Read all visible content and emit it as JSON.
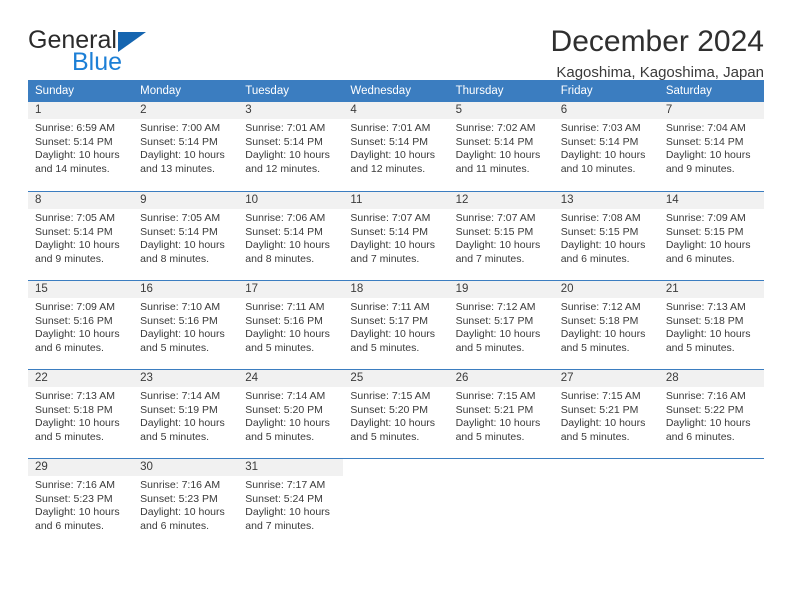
{
  "brand": {
    "word1": "General",
    "word2": "Blue",
    "triangle_color": "#1565b0",
    "blue_color": "#1c7fd6"
  },
  "header": {
    "title": "December 2024",
    "subtitle": "Kagoshima, Kagoshima, Japan"
  },
  "calendar": {
    "header_bg": "#3b7dc0",
    "daynum_bg": "#f1f1f1",
    "weekdays": [
      "Sunday",
      "Monday",
      "Tuesday",
      "Wednesday",
      "Thursday",
      "Friday",
      "Saturday"
    ],
    "weeks": [
      [
        {
          "day": "1",
          "sunrise": "Sunrise: 6:59 AM",
          "sunset": "Sunset: 5:14 PM",
          "daylight1": "Daylight: 10 hours",
          "daylight2": "and 14 minutes."
        },
        {
          "day": "2",
          "sunrise": "Sunrise: 7:00 AM",
          "sunset": "Sunset: 5:14 PM",
          "daylight1": "Daylight: 10 hours",
          "daylight2": "and 13 minutes."
        },
        {
          "day": "3",
          "sunrise": "Sunrise: 7:01 AM",
          "sunset": "Sunset: 5:14 PM",
          "daylight1": "Daylight: 10 hours",
          "daylight2": "and 12 minutes."
        },
        {
          "day": "4",
          "sunrise": "Sunrise: 7:01 AM",
          "sunset": "Sunset: 5:14 PM",
          "daylight1": "Daylight: 10 hours",
          "daylight2": "and 12 minutes."
        },
        {
          "day": "5",
          "sunrise": "Sunrise: 7:02 AM",
          "sunset": "Sunset: 5:14 PM",
          "daylight1": "Daylight: 10 hours",
          "daylight2": "and 11 minutes."
        },
        {
          "day": "6",
          "sunrise": "Sunrise: 7:03 AM",
          "sunset": "Sunset: 5:14 PM",
          "daylight1": "Daylight: 10 hours",
          "daylight2": "and 10 minutes."
        },
        {
          "day": "7",
          "sunrise": "Sunrise: 7:04 AM",
          "sunset": "Sunset: 5:14 PM",
          "daylight1": "Daylight: 10 hours",
          "daylight2": "and 9 minutes."
        }
      ],
      [
        {
          "day": "8",
          "sunrise": "Sunrise: 7:05 AM",
          "sunset": "Sunset: 5:14 PM",
          "daylight1": "Daylight: 10 hours",
          "daylight2": "and 9 minutes."
        },
        {
          "day": "9",
          "sunrise": "Sunrise: 7:05 AM",
          "sunset": "Sunset: 5:14 PM",
          "daylight1": "Daylight: 10 hours",
          "daylight2": "and 8 minutes."
        },
        {
          "day": "10",
          "sunrise": "Sunrise: 7:06 AM",
          "sunset": "Sunset: 5:14 PM",
          "daylight1": "Daylight: 10 hours",
          "daylight2": "and 8 minutes."
        },
        {
          "day": "11",
          "sunrise": "Sunrise: 7:07 AM",
          "sunset": "Sunset: 5:14 PM",
          "daylight1": "Daylight: 10 hours",
          "daylight2": "and 7 minutes."
        },
        {
          "day": "12",
          "sunrise": "Sunrise: 7:07 AM",
          "sunset": "Sunset: 5:15 PM",
          "daylight1": "Daylight: 10 hours",
          "daylight2": "and 7 minutes."
        },
        {
          "day": "13",
          "sunrise": "Sunrise: 7:08 AM",
          "sunset": "Sunset: 5:15 PM",
          "daylight1": "Daylight: 10 hours",
          "daylight2": "and 6 minutes."
        },
        {
          "day": "14",
          "sunrise": "Sunrise: 7:09 AM",
          "sunset": "Sunset: 5:15 PM",
          "daylight1": "Daylight: 10 hours",
          "daylight2": "and 6 minutes."
        }
      ],
      [
        {
          "day": "15",
          "sunrise": "Sunrise: 7:09 AM",
          "sunset": "Sunset: 5:16 PM",
          "daylight1": "Daylight: 10 hours",
          "daylight2": "and 6 minutes."
        },
        {
          "day": "16",
          "sunrise": "Sunrise: 7:10 AM",
          "sunset": "Sunset: 5:16 PM",
          "daylight1": "Daylight: 10 hours",
          "daylight2": "and 5 minutes."
        },
        {
          "day": "17",
          "sunrise": "Sunrise: 7:11 AM",
          "sunset": "Sunset: 5:16 PM",
          "daylight1": "Daylight: 10 hours",
          "daylight2": "and 5 minutes."
        },
        {
          "day": "18",
          "sunrise": "Sunrise: 7:11 AM",
          "sunset": "Sunset: 5:17 PM",
          "daylight1": "Daylight: 10 hours",
          "daylight2": "and 5 minutes."
        },
        {
          "day": "19",
          "sunrise": "Sunrise: 7:12 AM",
          "sunset": "Sunset: 5:17 PM",
          "daylight1": "Daylight: 10 hours",
          "daylight2": "and 5 minutes."
        },
        {
          "day": "20",
          "sunrise": "Sunrise: 7:12 AM",
          "sunset": "Sunset: 5:18 PM",
          "daylight1": "Daylight: 10 hours",
          "daylight2": "and 5 minutes."
        },
        {
          "day": "21",
          "sunrise": "Sunrise: 7:13 AM",
          "sunset": "Sunset: 5:18 PM",
          "daylight1": "Daylight: 10 hours",
          "daylight2": "and 5 minutes."
        }
      ],
      [
        {
          "day": "22",
          "sunrise": "Sunrise: 7:13 AM",
          "sunset": "Sunset: 5:18 PM",
          "daylight1": "Daylight: 10 hours",
          "daylight2": "and 5 minutes."
        },
        {
          "day": "23",
          "sunrise": "Sunrise: 7:14 AM",
          "sunset": "Sunset: 5:19 PM",
          "daylight1": "Daylight: 10 hours",
          "daylight2": "and 5 minutes."
        },
        {
          "day": "24",
          "sunrise": "Sunrise: 7:14 AM",
          "sunset": "Sunset: 5:20 PM",
          "daylight1": "Daylight: 10 hours",
          "daylight2": "and 5 minutes."
        },
        {
          "day": "25",
          "sunrise": "Sunrise: 7:15 AM",
          "sunset": "Sunset: 5:20 PM",
          "daylight1": "Daylight: 10 hours",
          "daylight2": "and 5 minutes."
        },
        {
          "day": "26",
          "sunrise": "Sunrise: 7:15 AM",
          "sunset": "Sunset: 5:21 PM",
          "daylight1": "Daylight: 10 hours",
          "daylight2": "and 5 minutes."
        },
        {
          "day": "27",
          "sunrise": "Sunrise: 7:15 AM",
          "sunset": "Sunset: 5:21 PM",
          "daylight1": "Daylight: 10 hours",
          "daylight2": "and 5 minutes."
        },
        {
          "day": "28",
          "sunrise": "Sunrise: 7:16 AM",
          "sunset": "Sunset: 5:22 PM",
          "daylight1": "Daylight: 10 hours",
          "daylight2": "and 6 minutes."
        }
      ],
      [
        {
          "day": "29",
          "sunrise": "Sunrise: 7:16 AM",
          "sunset": "Sunset: 5:23 PM",
          "daylight1": "Daylight: 10 hours",
          "daylight2": "and 6 minutes."
        },
        {
          "day": "30",
          "sunrise": "Sunrise: 7:16 AM",
          "sunset": "Sunset: 5:23 PM",
          "daylight1": "Daylight: 10 hours",
          "daylight2": "and 6 minutes."
        },
        {
          "day": "31",
          "sunrise": "Sunrise: 7:17 AM",
          "sunset": "Sunset: 5:24 PM",
          "daylight1": "Daylight: 10 hours",
          "daylight2": "and 7 minutes."
        },
        {
          "day": "",
          "sunrise": "",
          "sunset": "",
          "daylight1": "",
          "daylight2": ""
        },
        {
          "day": "",
          "sunrise": "",
          "sunset": "",
          "daylight1": "",
          "daylight2": ""
        },
        {
          "day": "",
          "sunrise": "",
          "sunset": "",
          "daylight1": "",
          "daylight2": ""
        },
        {
          "day": "",
          "sunrise": "",
          "sunset": "",
          "daylight1": "",
          "daylight2": ""
        }
      ]
    ]
  }
}
